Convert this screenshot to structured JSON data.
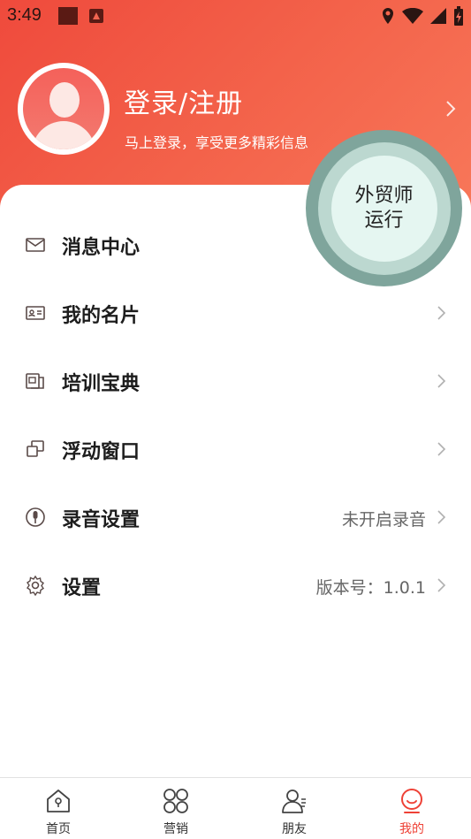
{
  "status_bar": {
    "time": "3:49"
  },
  "profile": {
    "title": "登录/注册",
    "subtitle": "马上登录，享受更多精彩信息"
  },
  "floating_widget": {
    "text": "外贸师\n运行",
    "line1": "外贸师",
    "line2": "运行"
  },
  "menu": [
    {
      "label": "消息中心",
      "value": "",
      "icon": "mail-icon"
    },
    {
      "label": "我的名片",
      "value": "",
      "icon": "id-card-icon"
    },
    {
      "label": "培训宝典",
      "value": "",
      "icon": "book-icon"
    },
    {
      "label": "浮动窗口",
      "value": "",
      "icon": "window-icon"
    },
    {
      "label": "录音设置",
      "value": "未开启录音",
      "icon": "microphone-icon"
    },
    {
      "label": "设置",
      "value": "版本号：1.0.1",
      "icon": "gear-icon"
    }
  ],
  "tabs": [
    {
      "label": "首页",
      "icon": "home-icon",
      "active": false
    },
    {
      "label": "营销",
      "icon": "grid-icon",
      "active": false
    },
    {
      "label": "朋友",
      "icon": "friends-icon",
      "active": false
    },
    {
      "label": "我的",
      "icon": "profile-icon",
      "active": true
    }
  ],
  "colors": {
    "accent": "#ee4136",
    "header_start": "#ef4a3c",
    "header_end": "#f8785a",
    "bubble": "#7fa59c"
  }
}
